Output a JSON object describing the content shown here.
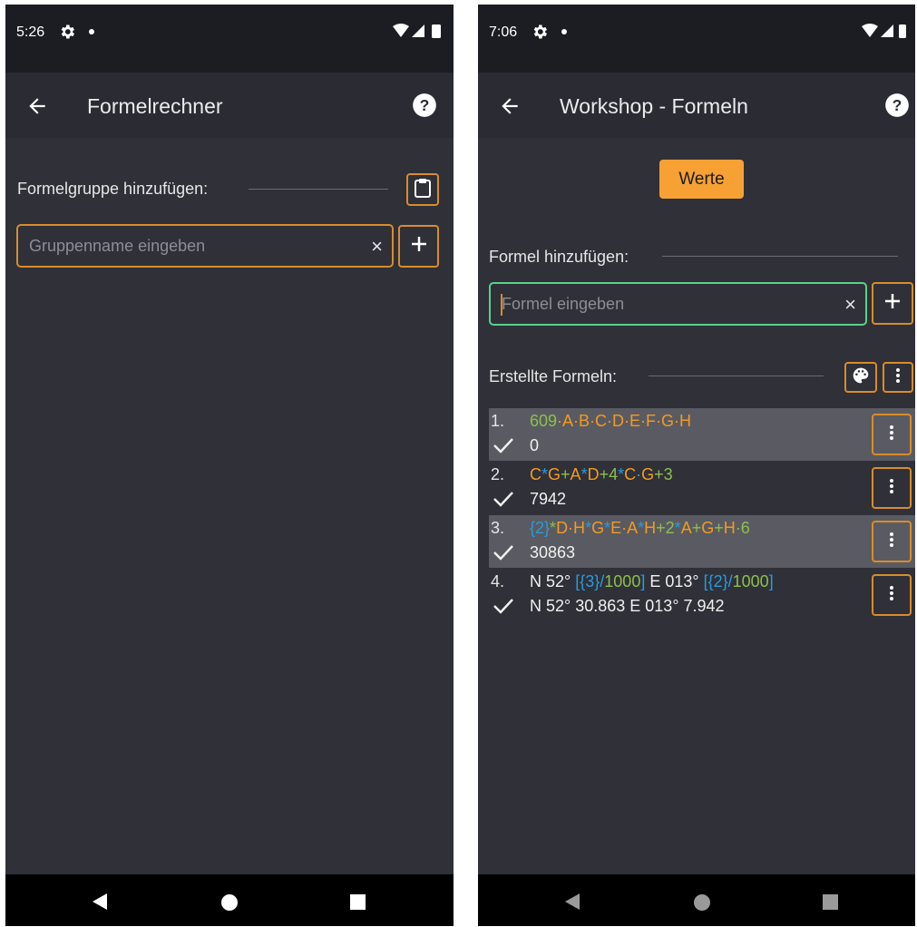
{
  "left_screen": {
    "status": {
      "time": "5:26",
      "icons": [
        "gear-icon",
        "dot-icon",
        "wifi-icon",
        "signal-icon",
        "battery-icon"
      ]
    },
    "appbar": {
      "title": "Formelrechner",
      "icons": [
        "back-arrow-icon",
        "help-icon"
      ]
    },
    "add_group": {
      "label": "Formelgruppe hinzufügen:",
      "input_placeholder": "Gruppenname eingeben",
      "clear_glyph": "×",
      "icons": [
        "clipboard-icon",
        "plus-icon",
        "clear-icon"
      ]
    }
  },
  "right_screen": {
    "status": {
      "time": "7:06",
      "icons": [
        "gear-icon",
        "dot-icon",
        "wifi-icon",
        "signal-icon",
        "battery-icon"
      ]
    },
    "appbar": {
      "title": "Workshop - Formeln",
      "icons": [
        "back-arrow-icon",
        "help-icon"
      ]
    },
    "values_button": "Werte",
    "add_formula": {
      "label": "Formel hinzufügen:",
      "input_placeholder": "Formel eingeben",
      "clear_glyph": "×",
      "icons": [
        "plus-icon",
        "clear-icon"
      ]
    },
    "created": {
      "label": "Erstellte Formeln:",
      "icons": [
        "palette-icon",
        "more-vert-icon"
      ]
    },
    "formulas": [
      {
        "index": "1.",
        "parts": [
          {
            "text": "609",
            "color": "green"
          },
          {
            "text": "·A·B·C·D·E·F·G·H",
            "color": "orange"
          }
        ],
        "result": "0",
        "shaded": true
      },
      {
        "index": "2.",
        "parts": [
          {
            "text": "C",
            "color": "orange"
          },
          {
            "text": "*",
            "color": "blue"
          },
          {
            "text": "G",
            "color": "orange"
          },
          {
            "text": "+",
            "color": "green"
          },
          {
            "text": "A",
            "color": "orange"
          },
          {
            "text": "*",
            "color": "blue"
          },
          {
            "text": "D",
            "color": "orange"
          },
          {
            "text": "+4",
            "color": "green"
          },
          {
            "text": "*",
            "color": "blue"
          },
          {
            "text": "C",
            "color": "orange"
          },
          {
            "text": "·",
            "color": "blue"
          },
          {
            "text": "G",
            "color": "orange"
          },
          {
            "text": "+3",
            "color": "green"
          }
        ],
        "result": "7942",
        "shaded": false
      },
      {
        "index": "3.",
        "parts": [
          {
            "text": "{2}",
            "color": "blue"
          },
          {
            "text": "*",
            "color": "green"
          },
          {
            "text": "D·H",
            "color": "orange"
          },
          {
            "text": "*",
            "color": "blue"
          },
          {
            "text": "G",
            "color": "orange"
          },
          {
            "text": "*",
            "color": "blue"
          },
          {
            "text": "E·A",
            "color": "orange"
          },
          {
            "text": "*",
            "color": "blue"
          },
          {
            "text": "H",
            "color": "orange"
          },
          {
            "text": "+2",
            "color": "green"
          },
          {
            "text": "*",
            "color": "blue"
          },
          {
            "text": "A",
            "color": "orange"
          },
          {
            "text": "+",
            "color": "green"
          },
          {
            "text": "G",
            "color": "orange"
          },
          {
            "text": "+",
            "color": "green"
          },
          {
            "text": "H",
            "color": "orange"
          },
          {
            "text": "·6",
            "color": "green"
          }
        ],
        "result": "30863",
        "shaded": true
      },
      {
        "index": "4.",
        "parts": [
          {
            "text": "N 52° ",
            "color": "white"
          },
          {
            "text": "[{3}/",
            "color": "blue"
          },
          {
            "text": "1000",
            "color": "green"
          },
          {
            "text": "]",
            "color": "blue"
          },
          {
            "text": "   E 013° ",
            "color": "white"
          },
          {
            "text": "[{2}/",
            "color": "blue"
          },
          {
            "text": "1000",
            "color": "green"
          },
          {
            "text": "]",
            "color": "blue"
          }
        ],
        "result": "N 52° 30.863   E 013° 7.942",
        "shaded": false
      }
    ]
  },
  "navbar": {
    "icons": [
      "nav-back-icon",
      "nav-home-icon",
      "nav-recent-icon"
    ]
  },
  "colors": {
    "background": "#2f3038",
    "accent": "#f7a134",
    "outline": "#d98c2b",
    "focus": "#59d18d",
    "green": "#8cc04b",
    "orange": "#f49a1f",
    "blue": "#2a9bdc"
  }
}
